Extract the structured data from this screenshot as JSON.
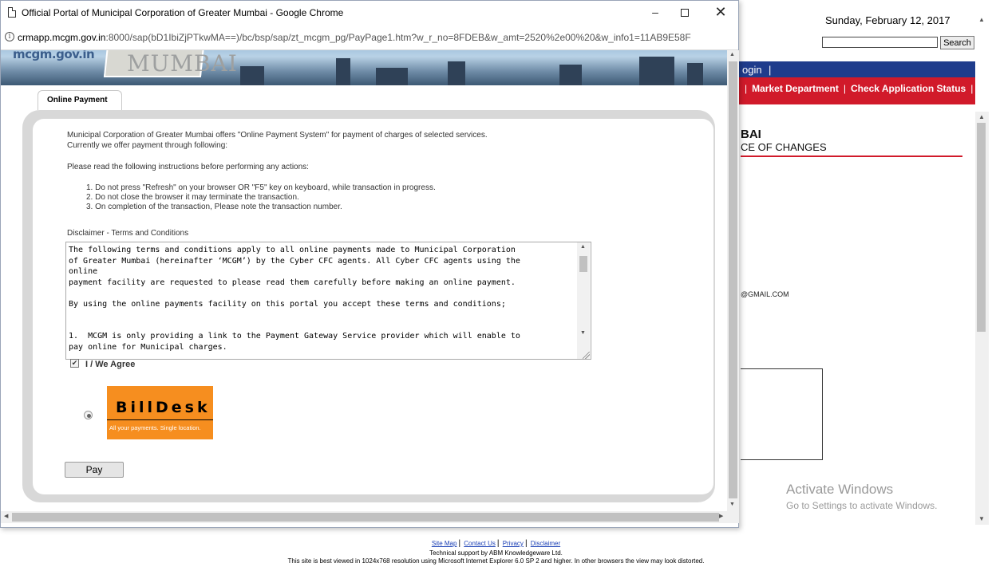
{
  "background_page": {
    "date": "Sunday, February 12, 2017",
    "search_button": "Search",
    "search_value": "",
    "nav_login": "ogin",
    "nav_separator": "|",
    "red_nav_prefix": "|",
    "red_nav_item_1": "Market Department",
    "red_nav_item_2": "Check Application Status",
    "red_nav_suffix": "|",
    "heading": "BAI",
    "subheading": "CE OF CHANGES",
    "email_fragment": "@GMAIL.COM",
    "watermark_title": "Activate Windows",
    "watermark_subtitle": "Go to Settings to activate Windows.",
    "footer": {
      "links": [
        "Site Map",
        "Contact Us",
        "Privacy",
        "Disclaimer"
      ],
      "support": "Technical support by ABM Knowledgeware Ltd.",
      "note": "This site is best viewed in 1024x768 resolution using Microsoft Internet Explorer 6.0 SP 2 and higher. In other browsers the view may look distorted."
    }
  },
  "popup": {
    "title": "Official Portal of Municipal Corporation of Greater Mumbai - Google Chrome",
    "url_host": "crmapp.mcgm.gov.in",
    "url_rest": ":8000/sap(bD1IbiZjPTkwMA==)/bc/bsp/sap/zt_mcgm_pg/PayPage1.htm?w_r_no=8FDEB&w_amt=2520%2e00%20&w_info1=11AB9E58F",
    "window_controls": {
      "minimize": "–",
      "close": "✕"
    },
    "banner": {
      "domain_text": "mcgm.gov.in",
      "sign_text": "MUMBAI"
    },
    "tab_label": "Online Payment",
    "intro_line_1": "Municipal Corporation of Greater Mumbai offers \"Online Payment System\" for payment of charges of selected services.",
    "intro_line_2": "Currently we offer payment through following:",
    "instructions_heading": "Please read the following instructions before performing any actions:",
    "instructions": [
      "1. Do not press \"Refresh\" on your browser OR \"F5\" key on keyboard, while transaction in progress.",
      "2. Do not close the browser it may terminate the transaction.",
      "3. On completion of the transaction, Please note the transaction number."
    ],
    "disclaimer_heading": "Disclaimer - Terms and Conditions",
    "terms_lines": [
      "The following terms and conditions apply to all online payments made to Municipal Corporation",
      "of Greater Mumbai (hereinafter ‘MCGM’) by the Cyber CFC agents. All Cyber CFC agents using the",
      "online",
      "payment facility are requested to please read them carefully before making an online payment.",
      "",
      "By using the online payments facility on this portal you accept these terms and conditions;",
      "",
      "",
      "1.  MCGM is only providing a link to the Payment Gateway Service provider which will enable to",
      "pay online for Municipal charges."
    ],
    "agree_label": "I / We Agree",
    "agree_checked": true,
    "gateway": {
      "logo_text": "BillDesk",
      "tagline": "All your payments. Single location.",
      "selected": true
    },
    "pay_button": "Pay"
  },
  "colors": {
    "nav_blue": "#1f3c8c",
    "nav_red": "#d11a2a",
    "billdesk_orange": "#f68e1f",
    "panel_grey": "#d8d8d8"
  }
}
